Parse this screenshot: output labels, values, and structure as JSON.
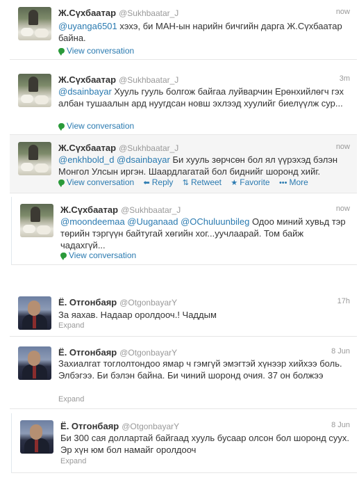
{
  "tweets_a": [
    {
      "name": "Ж.Сүхбаатар",
      "handle": "@Sukhbaatar_J",
      "time": "now",
      "mention": "@uyanga6501",
      "text": " хэхэ, би МАН-ын нарийн бичгийн дарга Ж.Сүхбаатар байна.",
      "view_conversation": "View conversation"
    },
    {
      "name": "Ж.Сүхбаатар",
      "handle": "@Sukhbaatar_J",
      "time": "3m",
      "mention": "@dsainbayar",
      "text": " Хууль гууль болгож байгаа луйварчин Ерөнхийлөгч гэх албан тушаалын ард нуугдсан новш эхлээд хуулийг биелүүлж сур...",
      "view_conversation": "View conversation"
    },
    {
      "name": "Ж.Сүхбаатар",
      "handle": "@Sukhbaatar_J",
      "time": "now",
      "mention": "@enkhbold_d @dsainbayar",
      "text": " Би хууль зөрчсөн бол ял үүрэхэд бэлэн Монгол Улсын иргэн. Шаардлагатай бол биднийг шоронд хийг.",
      "view_conversation": "View conversation",
      "reply": "Reply",
      "retweet": "Retweet",
      "favorite": "Favorite",
      "more": "More"
    },
    {
      "name": "Ж.Сүхбаатар",
      "handle": "@Sukhbaatar_J",
      "time": "now",
      "mention": "@moondeemaa @Uuganaad @OChuluunbileg",
      "text": " Одоо миний хувьд тэр төрийн тэргүүн байтугай хөгийн хог...уучлаарай. Том байж чадахгүй...",
      "view_conversation": "View conversation"
    }
  ],
  "tweets_b": [
    {
      "name": "Ё. Отгонбаяр",
      "handle": "@OtgonbayarY",
      "time": "17h",
      "text": "За яахав. Надаар оролдооч.! Чаддым",
      "expand": "Expand"
    },
    {
      "name": "Ё. Отгонбаяр",
      "handle": "@OtgonbayarY",
      "time": "8 Jun",
      "text": "Захиалгат тоглолтондоо ямар ч гэмгүй эмэгтэй хүнээр хийхээ боль. Элбэгээ. Би бэлэн байна. Би чиний шоронд очия. 37 он болжээ",
      "expand": "Expand"
    },
    {
      "name": "Ё. Отгонбаяр",
      "handle": "@OtgonbayarY",
      "time": "8 Jun",
      "text": "Би 300 сая доллартай байгаад хууль бусаар олсон бол шоронд суух. Эр хүн юм бол намайг оролдооч",
      "expand": "Expand"
    }
  ]
}
